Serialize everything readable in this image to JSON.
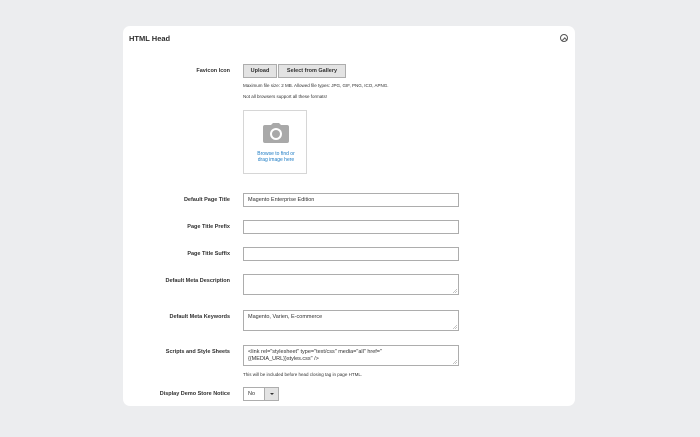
{
  "section": {
    "title": "HTML Head"
  },
  "favicon": {
    "label": "Favicon Icon",
    "upload_label": "Upload",
    "gallery_label": "Select from Gallery",
    "note_size": "Maximum file size: 2 MB. Allowed file types: JPG, GIF, PNG, ICO, APNG.",
    "note_support": "Not all browsers support all these formats!",
    "dropzone_line1": "Browse to find or",
    "dropzone_line2": "drag image here"
  },
  "fields": {
    "default_title": {
      "label": "Default Page Title",
      "value": "Magento Enterprise Edition"
    },
    "title_prefix": {
      "label": "Page Title Prefix",
      "value": ""
    },
    "title_suffix": {
      "label": "Page Title Suffix",
      "value": ""
    },
    "meta_description": {
      "label": "Default Meta Description",
      "value": ""
    },
    "meta_keywords": {
      "label": "Default Meta Keywords",
      "value": "Magento, Varien, E-commerce"
    },
    "scripts": {
      "label": "Scripts and Style Sheets",
      "value_line1": "<link  rel=\"stylesheet\" type=\"text/css\"  media=\"all\" href=\"",
      "value_line2": "{{MEDIA_URL}}styles.css\" />",
      "note": "This will be included before head closing tag in page HTML."
    },
    "demo_notice": {
      "label": "Display Demo Store Notice",
      "value": "No"
    }
  }
}
